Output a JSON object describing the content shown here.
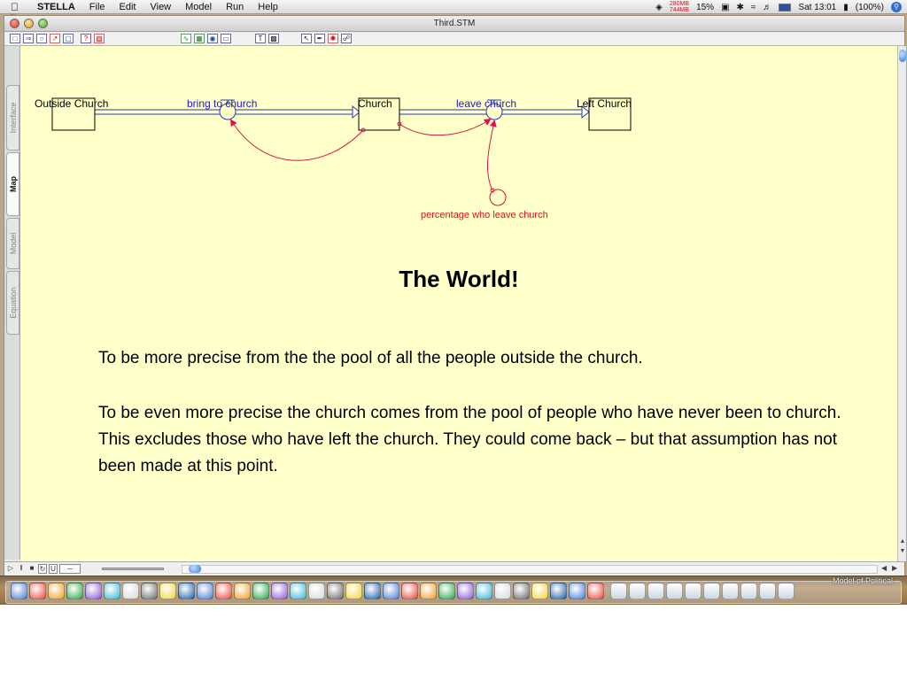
{
  "menubar": {
    "app": "STELLA",
    "menus": [
      "File",
      "Edit",
      "View",
      "Model",
      "Run",
      "Help"
    ],
    "memory_used": "280MB",
    "memory_free": "744MB",
    "cpu": "15%",
    "clock": "Sat 13:01",
    "battery": "(100%)"
  },
  "window": {
    "title": "Third.STM"
  },
  "sidetabs": [
    "Interface",
    "Map",
    "Model",
    "Equation"
  ],
  "active_tab": "Map",
  "diagram": {
    "stocks": [
      "Outside Church",
      "Church",
      "Left Church"
    ],
    "flows": [
      "bring to church",
      "leave church"
    ],
    "converter": "percentage who leave church",
    "colors": {
      "flow_label": "#1b17d6",
      "converter": "#e0101a",
      "connector": "#e0104f",
      "canvas": "#ffffc9"
    }
  },
  "slide": {
    "title": "The World!",
    "para1": "To be more precise from the the pool of all the people outside the church.",
    "para2": "To be even more precise the church comes from the pool of people who have never been to church. This excludes those who have left the church. They could come back – but that assumption has not been made at this point."
  },
  "dock": {
    "label": "Model of Political"
  }
}
